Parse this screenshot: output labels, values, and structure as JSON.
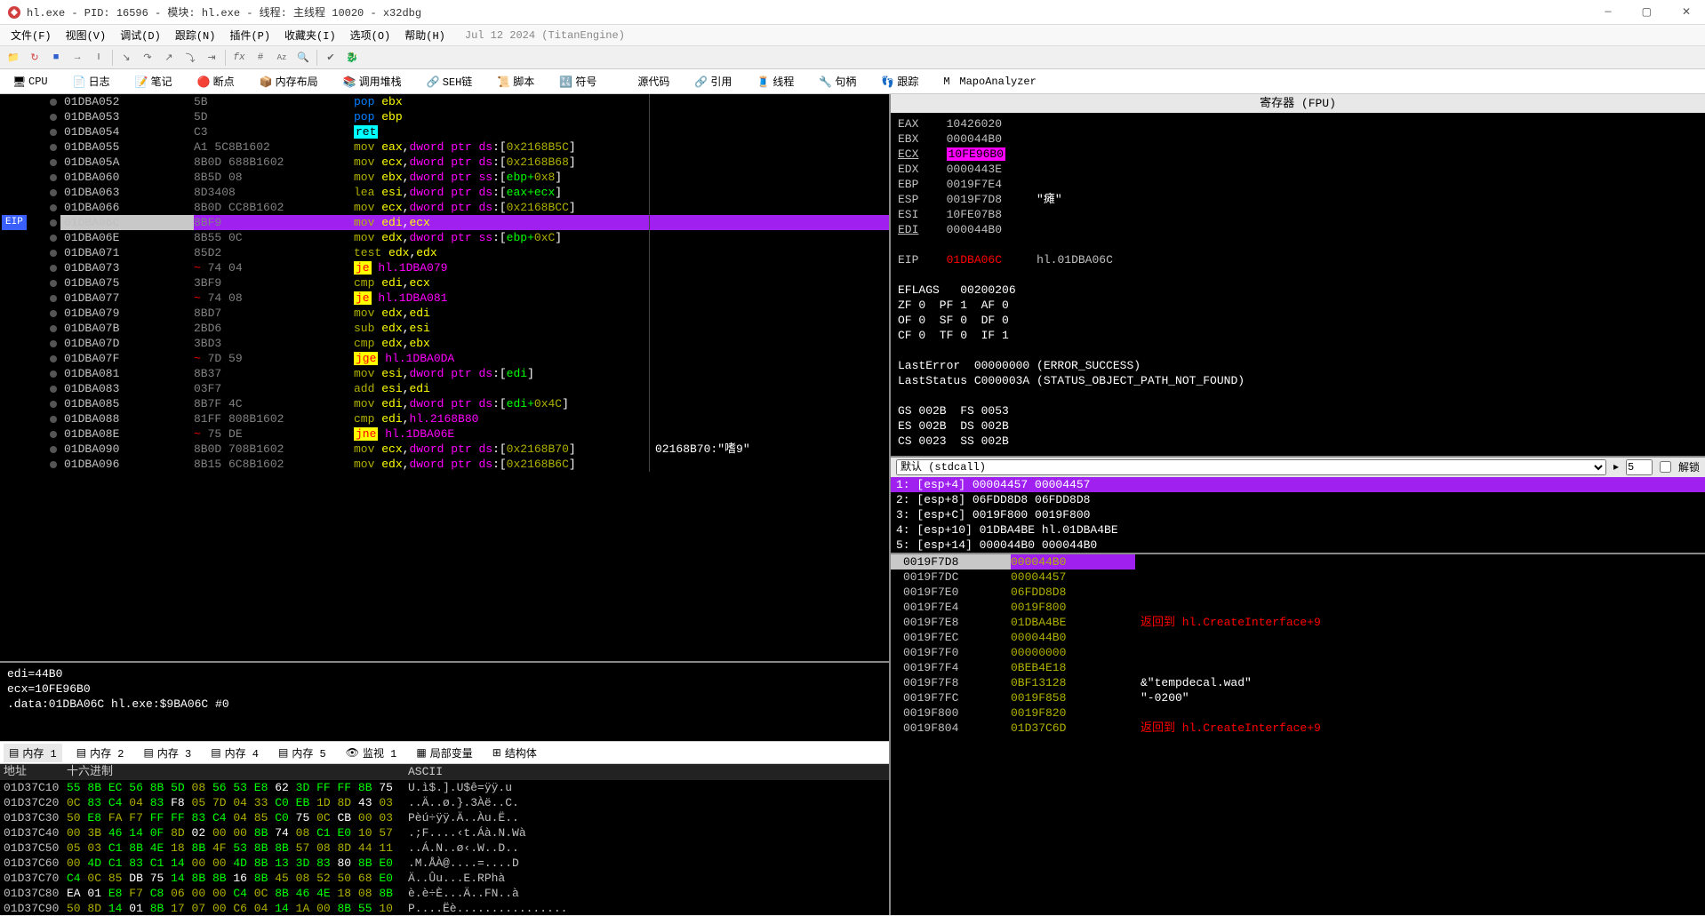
{
  "title": "hl.exe - PID: 16596 - 模块: hl.exe - 线程: 主线程 10020 - x32dbg",
  "menus": [
    "文件(F)",
    "视图(V)",
    "调试(D)",
    "跟踪(N)",
    "插件(P)",
    "收藏夹(I)",
    "选项(O)",
    "帮助(H)"
  ],
  "menu_date": "Jul 12 2024 (TitanEngine)",
  "tabs": [
    "CPU",
    "日志",
    "笔记",
    "断点",
    "内存布局",
    "调用堆栈",
    "SEH链",
    "脚本",
    "符号",
    "源代码",
    "引用",
    "线程",
    "句柄",
    "跟踪",
    "MapoAnalyzer"
  ],
  "disasm": [
    {
      "addr": "01DBA052",
      "bytes": "5B",
      "op": "pop",
      "args": "ebx",
      "type": "pop"
    },
    {
      "addr": "01DBA053",
      "bytes": "5D",
      "op": "pop",
      "args": "ebp",
      "type": "pop"
    },
    {
      "addr": "01DBA054",
      "bytes": "C3",
      "op": "ret",
      "args": "",
      "type": "ret"
    },
    {
      "addr": "01DBA055",
      "bytes": "A1 5C8B1602",
      "op": "mov",
      "args": "eax,dword ptr ds:[0x2168B5C]",
      "type": "mov"
    },
    {
      "addr": "01DBA05A",
      "bytes": "8B0D 688B1602",
      "op": "mov",
      "args": "ecx,dword ptr ds:[0x2168B68]",
      "type": "mov"
    },
    {
      "addr": "01DBA060",
      "bytes": "8B5D 08",
      "op": "mov",
      "args": "ebx,dword ptr ss:[ebp+0x8]",
      "type": "mov"
    },
    {
      "addr": "01DBA063",
      "bytes": "8D3408",
      "op": "lea",
      "args": "esi,dword ptr ds:[eax+ecx]",
      "type": "lea"
    },
    {
      "addr": "01DBA066",
      "bytes": "8B0D CC8B1602",
      "op": "mov",
      "args": "ecx,dword ptr ds:[0x2168BCC]",
      "type": "mov"
    },
    {
      "addr": "01DBA06C",
      "bytes": "8BF9",
      "op": "mov",
      "args": "edi,ecx",
      "type": "mov",
      "eip": true
    },
    {
      "addr": "01DBA06E",
      "bytes": "8B55 0C",
      "op": "mov",
      "args": "edx,dword ptr ss:[ebp+0xC]",
      "type": "mov"
    },
    {
      "addr": "01DBA071",
      "bytes": "85D2",
      "op": "test",
      "args": "edx,edx",
      "type": "test"
    },
    {
      "addr": "01DBA073",
      "bytes": "74 04",
      "op": "je",
      "args": "hl.1DBA079",
      "type": "je",
      "dash": true
    },
    {
      "addr": "01DBA075",
      "bytes": "3BF9",
      "op": "cmp",
      "args": "edi,ecx",
      "type": "cmp"
    },
    {
      "addr": "01DBA077",
      "bytes": "74 08",
      "op": "je",
      "args": "hl.1DBA081",
      "type": "je",
      "dash": true
    },
    {
      "addr": "01DBA079",
      "bytes": "8BD7",
      "op": "mov",
      "args": "edx,edi",
      "type": "mov"
    },
    {
      "addr": "01DBA07B",
      "bytes": "2BD6",
      "op": "sub",
      "args": "edx,esi",
      "type": "sub"
    },
    {
      "addr": "01DBA07D",
      "bytes": "3BD3",
      "op": "cmp",
      "args": "edx,ebx",
      "type": "cmp"
    },
    {
      "addr": "01DBA07F",
      "bytes": "7D 59",
      "op": "jge",
      "args": "hl.1DBA0DA",
      "type": "jge",
      "dash": true
    },
    {
      "addr": "01DBA081",
      "bytes": "8B37",
      "op": "mov",
      "args": "esi,dword ptr ds:[edi]",
      "type": "mov"
    },
    {
      "addr": "01DBA083",
      "bytes": "03F7",
      "op": "add",
      "args": "esi,edi",
      "type": "add"
    },
    {
      "addr": "01DBA085",
      "bytes": "8B7F 4C",
      "op": "mov",
      "args": "edi,dword ptr ds:[edi+0x4C]",
      "type": "mov"
    },
    {
      "addr": "01DBA088",
      "bytes": "81FF 808B1602",
      "op": "cmp",
      "args": "edi,hl.2168B80",
      "type": "cmp"
    },
    {
      "addr": "01DBA08E",
      "bytes": "75 DE",
      "op": "jne",
      "args": "hl.1DBA06E",
      "type": "jne",
      "dash": true
    },
    {
      "addr": "01DBA090",
      "bytes": "8B0D 708B1602",
      "op": "mov",
      "args": "ecx,dword ptr ds:[0x2168B70]",
      "type": "mov",
      "comment": "02168B70:\"嗜9\""
    },
    {
      "addr": "01DBA096",
      "bytes": "8B15 6C8B1602",
      "op": "mov",
      "args": "edx,dword ptr ds:[0x2168B6C]",
      "type": "mov"
    }
  ],
  "info_lines": [
    "edi=44B0",
    "ecx=10FE96B0",
    "",
    ".data:01DBA06C hl.exe:$9BA06C #0"
  ],
  "mem_tabs": [
    "内存 1",
    "内存 2",
    "内存 3",
    "内存 4",
    "内存 5",
    "监视 1",
    "局部变量",
    "结构体"
  ],
  "hex_headers": {
    "addr": "地址",
    "bytes": "十六进制",
    "ascii": "ASCII"
  },
  "hex_rows": [
    {
      "addr": "01D37C10",
      "bytes": "55 8B EC 56 8B 5D 08 56 53 E8 62 3D FF FF 8B 75",
      "ascii": "U.ì$.].U$ê=ÿÿ.u"
    },
    {
      "addr": "01D37C20",
      "bytes": "0C 83 C4 04 83 F8 05 7D 04 33 C0 EB 1D 8D 43 03",
      "ascii": "..Ä..ø.}.3Àë..C."
    },
    {
      "addr": "01D37C30",
      "bytes": "50 E8 FA F7 FF FF 83 C4 04 85 C0 75 0C CB 00 03",
      "ascii": "Pèú÷ÿÿ.Ä..Àu.Ë.."
    },
    {
      "addr": "01D37C40",
      "bytes": "00 3B 46 14 0F 8D 02 00 00 8B 74 08 C1 E0 10 57",
      "ascii": ".;F....‹t.Áà.N.Wà"
    },
    {
      "addr": "01D37C50",
      "bytes": "05 03 C1 8B 4E 18 8B 4F 53 8B 8B 57 08 8D 44 11",
      "ascii": "..Á.N..ø‹.W..D.."
    },
    {
      "addr": "01D37C60",
      "bytes": "00 4D C1 83 C1 14 00 00 4D 8B 13 3D 83 80 8B E0",
      "ascii": ".M.ÅÀ@....=....D"
    },
    {
      "addr": "01D37C70",
      "bytes": "C4 0C 85 DB 75 14 8B 8B 16 8B 45 08 52 50 68 E0",
      "ascii": "Ä..Ûu...E.RPhà"
    },
    {
      "addr": "01D37C80",
      "bytes": "EA 01 E8 F7 C8 06 00 00 C4 0C 8B 46 4E 18 08 8B",
      "ascii": "è.è÷È...Ä..FN..à"
    },
    {
      "addr": "01D37C90",
      "bytes": "50 8D 14 01 8B 17 07 00 C6 04 14 1A 00 8B 55 10",
      "ascii": "P....Ëè................"
    }
  ],
  "reg_title": "寄存器 (FPU)",
  "registers": [
    {
      "name": "EAX",
      "val": "10426020"
    },
    {
      "name": "EBX",
      "val": "000044B0"
    },
    {
      "name": "ECX",
      "val": "10FE96B0",
      "underline": true,
      "hl": true
    },
    {
      "name": "EDX",
      "val": "0000443E"
    },
    {
      "name": "EBP",
      "val": "0019F7E4"
    },
    {
      "name": "ESP",
      "val": "0019F7D8",
      "extra": "     \"瘫\""
    },
    {
      "name": "ESI",
      "val": "10FE07B8"
    },
    {
      "name": "EDI",
      "val": "000044B0",
      "underline": true
    }
  ],
  "eip": {
    "name": "EIP",
    "val": "01DBA06C",
    "sym": "hl.01DBA06C"
  },
  "eflags": "EFLAGS   00200206",
  "flags": [
    "ZF 0  PF 1  AF 0",
    "OF 0  SF 0  DF 0",
    "CF 0  TF 0  IF 1"
  ],
  "last_error": "LastError  00000000 (ERROR_SUCCESS)",
  "last_status": "LastStatus C000003A (STATUS_OBJECT_PATH_NOT_FOUND)",
  "segs": [
    "GS 002B  FS 0053",
    "ES 002B  DS 002B",
    "CS 0023  SS 002B"
  ],
  "args_label": "默认 (stdcall)",
  "args_count": "5",
  "args_lock": "解锁",
  "args": [
    {
      "n": "1:",
      "txt": "[esp+4] 00004457 00004457",
      "sel": true
    },
    {
      "n": "2:",
      "txt": "[esp+8] 06FDD8D8 06FDD8D8"
    },
    {
      "n": "3:",
      "txt": "[esp+C] 0019F800 0019F800"
    },
    {
      "n": "4:",
      "txt": "[esp+10] 01DBA4BE hl.01DBA4BE"
    },
    {
      "n": "5:",
      "txt": "[esp+14] 000044B0 000044B0"
    }
  ],
  "stack": [
    {
      "addr": "0019F7D8",
      "val": "000044B0",
      "sel": true
    },
    {
      "addr": "0019F7DC",
      "val": "00004457"
    },
    {
      "addr": "0019F7E0",
      "val": "06FDD8D8"
    },
    {
      "addr": "0019F7E4",
      "val": "0019F800"
    },
    {
      "addr": "0019F7E8",
      "val": "01DBA4BE",
      "comment": "返回到 hl.CreateInterface+9"
    },
    {
      "addr": "0019F7EC",
      "val": "000044B0"
    },
    {
      "addr": "0019F7F0",
      "val": "00000000"
    },
    {
      "addr": "0019F7F4",
      "val": "0BEB4E18"
    },
    {
      "addr": "0019F7F8",
      "val": "0BF13128",
      "comment": "&\"tempdecal.wad\"",
      "white": true
    },
    {
      "addr": "0019F7FC",
      "val": "0019F858",
      "comment": "\"-0200\"",
      "white": true
    },
    {
      "addr": "0019F800",
      "val": "0019F820"
    },
    {
      "addr": "0019F804",
      "val": "01D37C6D",
      "comment": "返回到 hl.CreateInterface+9"
    }
  ]
}
